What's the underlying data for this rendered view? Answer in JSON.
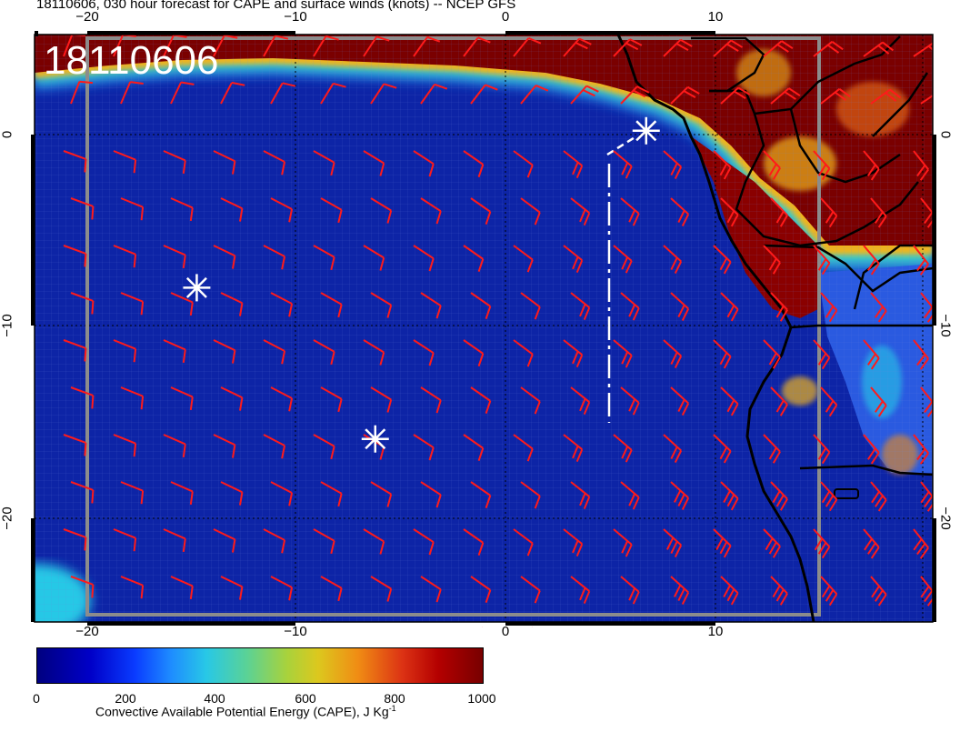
{
  "title": "18110606, 030 hour forecast for CAPE and surface winds (knots) -- NCEP GFS",
  "stamp": "18110606",
  "lon_ticks_top": [
    "−20",
    "−10",
    "0",
    "10"
  ],
  "lon_ticks_bottom": [
    "−20",
    "−10",
    "0",
    "10"
  ],
  "lat_ticks": [
    "0",
    "−10",
    "−20"
  ],
  "colorbar": {
    "ticks": [
      "0",
      "200",
      "400",
      "600",
      "800",
      "1000"
    ],
    "label": "Convective Available Potential Energy (CAPE), J Kg",
    "label_sup": "-1"
  },
  "colors": {
    "wind_barb": "#ff1a1a",
    "ocean_low_cape": "#0a1f9a",
    "high_cape": "#7a0000",
    "markers": "#ffffff"
  },
  "markers": [
    {
      "name": "star-marker-1",
      "lon": 6.7,
      "lat": 0.2
    },
    {
      "name": "star-marker-2",
      "lon": -14.7,
      "lat": -8.0
    },
    {
      "name": "star-marker-3",
      "lon": -6.2,
      "lat": -15.9
    }
  ]
}
